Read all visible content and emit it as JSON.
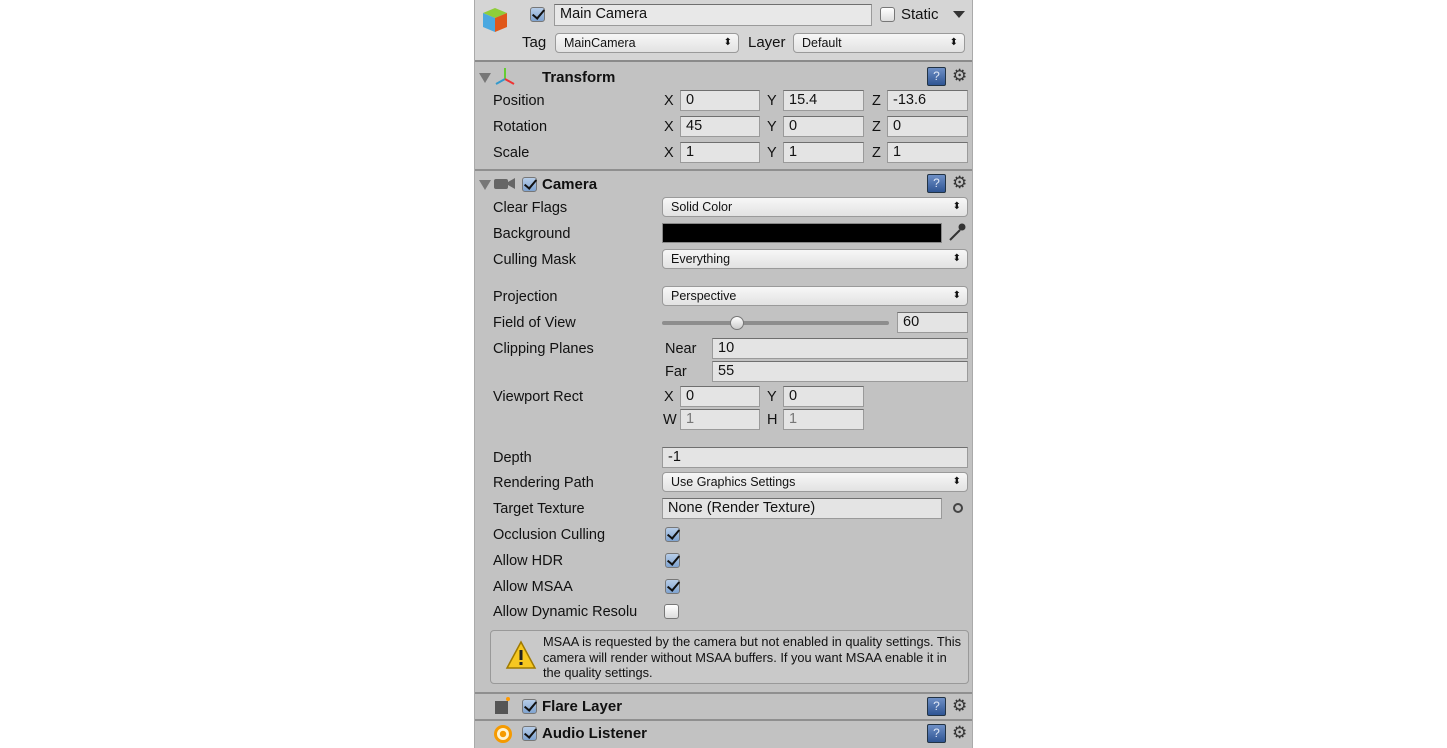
{
  "header": {
    "name": "Main Camera",
    "active": true,
    "static_label": "Static",
    "static_checked": false,
    "tag_label": "Tag",
    "tag_value": "MainCamera",
    "layer_label": "Layer",
    "layer_value": "Default"
  },
  "transform": {
    "title": "Transform",
    "rows": [
      {
        "label": "Position",
        "x": "0",
        "y": "15.4",
        "z": "-13.6"
      },
      {
        "label": "Rotation",
        "x": "45",
        "y": "0",
        "z": "0"
      },
      {
        "label": "Scale",
        "x": "1",
        "y": "1",
        "z": "1"
      }
    ],
    "axis": {
      "x": "X",
      "y": "Y",
      "z": "Z"
    }
  },
  "camera": {
    "title": "Camera",
    "enabled": true,
    "clear_flags": {
      "label": "Clear Flags",
      "value": "Solid Color"
    },
    "background": {
      "label": "Background",
      "color": "#000000"
    },
    "culling_mask": {
      "label": "Culling Mask",
      "value": "Everything"
    },
    "projection": {
      "label": "Projection",
      "value": "Perspective"
    },
    "fov": {
      "label": "Field of View",
      "value": "60",
      "min": 1,
      "max": 179
    },
    "clipping": {
      "label": "Clipping Planes",
      "near_label": "Near",
      "near": "10",
      "far_label": "Far",
      "far": "55"
    },
    "viewport": {
      "label": "Viewport Rect",
      "x_label": "X",
      "x": "0",
      "y_label": "Y",
      "y": "0",
      "w_label": "W",
      "w": "1",
      "h_label": "H",
      "h": "1"
    },
    "depth": {
      "label": "Depth",
      "value": "-1"
    },
    "rendering_path": {
      "label": "Rendering Path",
      "value": "Use Graphics Settings"
    },
    "target_texture": {
      "label": "Target Texture",
      "value": "None (Render Texture)"
    },
    "occlusion": {
      "label": "Occlusion Culling",
      "checked": true
    },
    "hdr": {
      "label": "Allow HDR",
      "checked": true
    },
    "msaa": {
      "label": "Allow MSAA",
      "checked": true
    },
    "dynres": {
      "label": "Allow Dynamic Resolu",
      "checked": false
    },
    "warning": "MSAA is requested by the camera but not enabled in quality settings. This camera will render without MSAA buffers. If you want MSAA enable it in the quality settings."
  },
  "flare": {
    "title": "Flare Layer",
    "enabled": true
  },
  "audio": {
    "title": "Audio Listener",
    "enabled": true
  },
  "icons": {
    "help": "?",
    "gear": "⚙",
    "dropdown": "⬍"
  }
}
